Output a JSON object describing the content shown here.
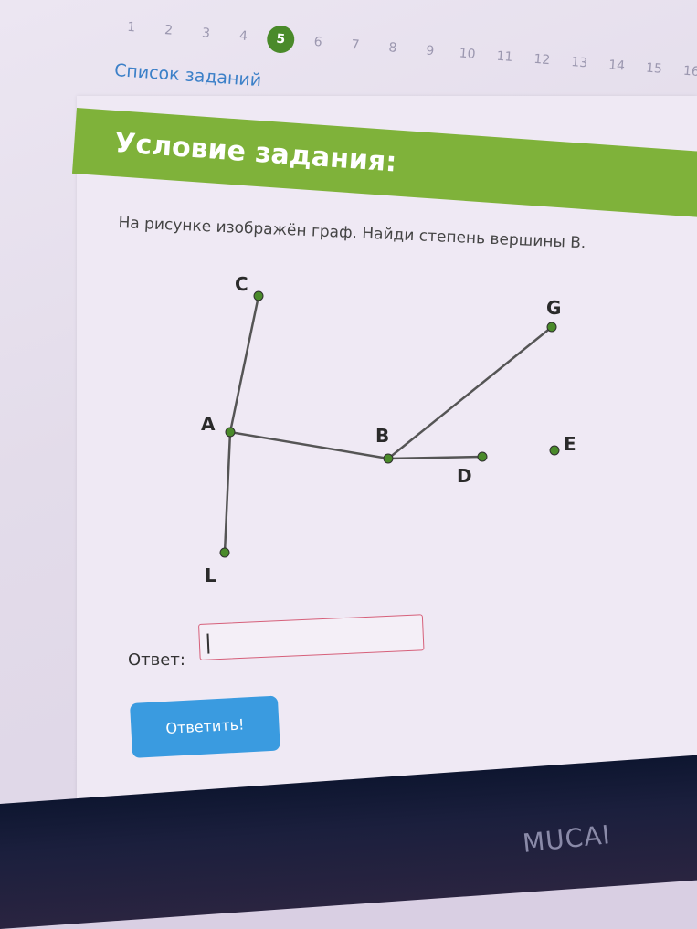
{
  "pagination": {
    "pages": [
      "1",
      "2",
      "3",
      "4",
      "5",
      "6",
      "7",
      "8",
      "9",
      "10",
      "11",
      "12",
      "13",
      "14",
      "15",
      "16"
    ],
    "active": "5"
  },
  "nav": {
    "task_list_label": "Список заданий"
  },
  "header": {
    "title": "Условие задания:"
  },
  "question": {
    "text": "На рисунке изображён граф. Найди степень вершины B."
  },
  "graph": {
    "vertices": [
      {
        "id": "C",
        "label": "C"
      },
      {
        "id": "G",
        "label": "G"
      },
      {
        "id": "A",
        "label": "A"
      },
      {
        "id": "B",
        "label": "B"
      },
      {
        "id": "D",
        "label": "D"
      },
      {
        "id": "E",
        "label": "E"
      },
      {
        "id": "L",
        "label": "L"
      }
    ],
    "edges": [
      [
        "A",
        "C"
      ],
      [
        "A",
        "B"
      ],
      [
        "A",
        "L"
      ],
      [
        "B",
        "G"
      ],
      [
        "B",
        "D"
      ]
    ],
    "vertex_color": "#4a8a2a",
    "edge_color": "#555555"
  },
  "answer": {
    "label": "Ответ:",
    "value": ""
  },
  "submit": {
    "label": "Ответить!"
  },
  "colors": {
    "header": "#7fb23a",
    "link": "#3c80c8",
    "button": "#3a9be0",
    "input_border": "#d6607a"
  },
  "device": {
    "brand": "MUCAI"
  }
}
